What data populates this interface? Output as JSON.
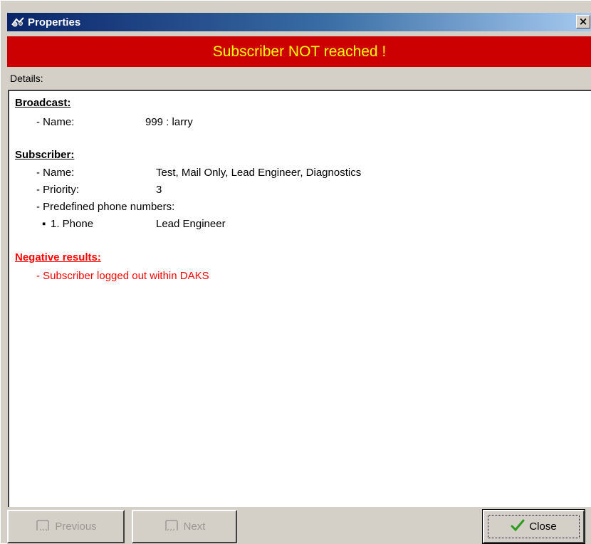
{
  "window": {
    "title": "Properties",
    "close_glyph": "×"
  },
  "banner": {
    "text": "Subscriber NOT reached !",
    "background_color": "#cc0000",
    "text_color": "#ffff00"
  },
  "details_label": "Details:",
  "details": {
    "broadcast": {
      "heading": "Broadcast:",
      "name_label": "- Name:",
      "name_value": "999 : larry"
    },
    "subscriber": {
      "heading": "Subscriber:",
      "name_label": "- Name:",
      "name_value": "Test, Mail Only, Lead Engineer, Diagnostics",
      "priority_label": "- Priority:",
      "priority_value": "3",
      "phones_label": "- Predefined phone numbers:",
      "phone_bullet": "▪",
      "phone_label": "1. Phone",
      "phone_value": "Lead Engineer"
    },
    "negative": {
      "heading": "Negative results:",
      "item": "- Subscriber logged out within DAKS",
      "color": "#ff0000"
    }
  },
  "buttons": {
    "previous": {
      "label": "Previous",
      "icon": "door-icon"
    },
    "next": {
      "label": "Next",
      "icon": "door-icon"
    },
    "close": {
      "label": "Close",
      "icon": "checkmark-icon"
    }
  }
}
